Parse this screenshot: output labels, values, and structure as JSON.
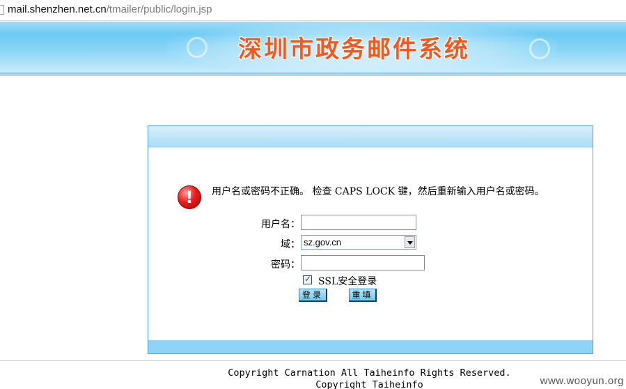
{
  "browser": {
    "url_host": "mail.shenzhen.net.cn",
    "url_path": "/tmailer/public/login.jsp"
  },
  "banner": {
    "title": "深圳市政务邮件系统"
  },
  "login": {
    "error_message": "用户名或密码不正确。 检查 CAPS LOCK 键，然后重新输入用户名或密码。",
    "username_label": "用户名：",
    "username_value": "",
    "domain_label": "域：",
    "domain_value": "sz.gov.cn",
    "password_label": "密码：",
    "password_value": "",
    "ssl_label": "SSL安全登录",
    "ssl_checked": true,
    "login_button": "登录",
    "reset_button": "重填"
  },
  "footer": {
    "copyright_line1": "Copyright Carnation All Taiheinfo Rights Reserved.",
    "copyright_line2": "Copyright Taiheinfo"
  },
  "watermark": "www.wooyun.org",
  "colors": {
    "banner_title": "#f05a1e",
    "panel_border": "#4f9ecf",
    "panel_band": "#8fd3f6",
    "error_icon": "#e52020"
  }
}
